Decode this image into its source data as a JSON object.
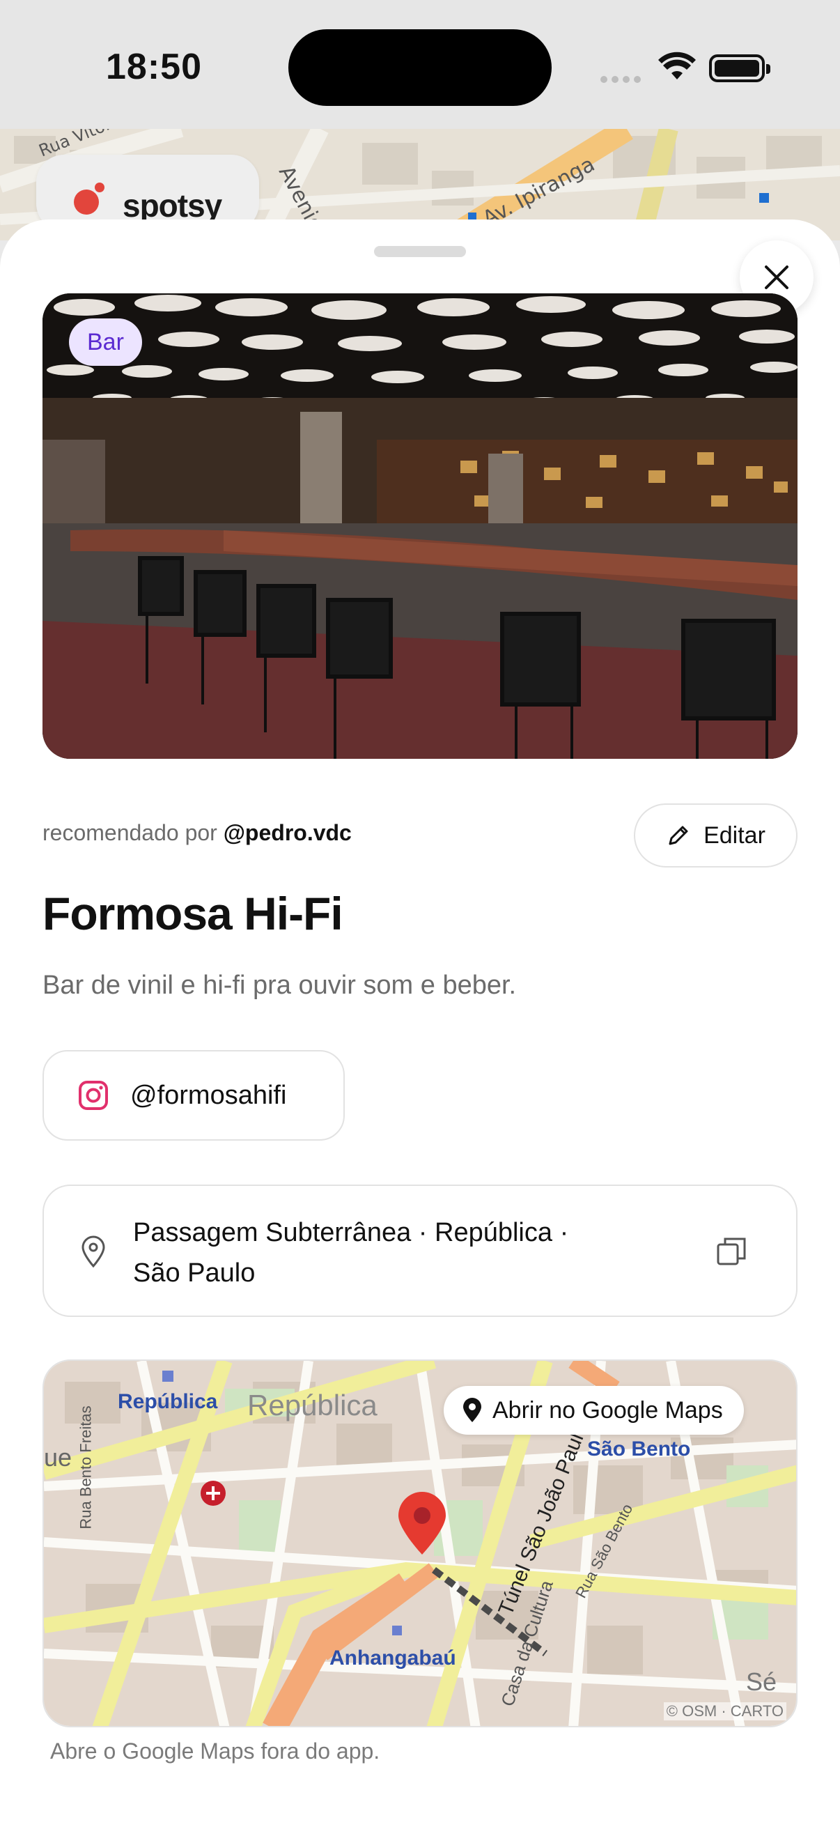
{
  "status_bar": {
    "time": "18:50"
  },
  "app": {
    "brand": "spotsy"
  },
  "place": {
    "category": "Bar",
    "recommended_prefix": "recomendado por",
    "recommended_user": "@pedro.vdc",
    "edit_label": "Editar",
    "name": "Formosa Hi-Fi",
    "description": "Bar de vinil e hi-fi pra ouvir som e beber.",
    "instagram": "@formosahifi",
    "address_line1": "Passagem Subterrânea · República ·",
    "address_line2": "São Paulo"
  },
  "map": {
    "open_button": "Abrir no Google Maps",
    "labels": {
      "republica_station": "República",
      "republica_district": "República",
      "sao_bento": "São Bento",
      "anhangabau": "Anhangabaú",
      "rua_bento_freitas": "Rua Bento Freitas",
      "tunel": "Túnel São João Paulo",
      "rua_sao_bento": "Rua São Bento",
      "casa_cultura": "Casa da Cultura",
      "ue": "ue",
      "se": "Sé"
    },
    "attribution": "© OSM · CARTO",
    "hint": "Abre o Google Maps fora do app."
  },
  "background_map": {
    "labels": {
      "av_rio": "Avenida Rio",
      "av_ipiranga": "Av. Ipiranga",
      "rua_vitoria": "Rua Vitória"
    }
  },
  "colors": {
    "accent": "#5b2bd1",
    "tag_bg": "#ece4ff",
    "pin": "#e53a30",
    "instagram": "#e1306c"
  }
}
